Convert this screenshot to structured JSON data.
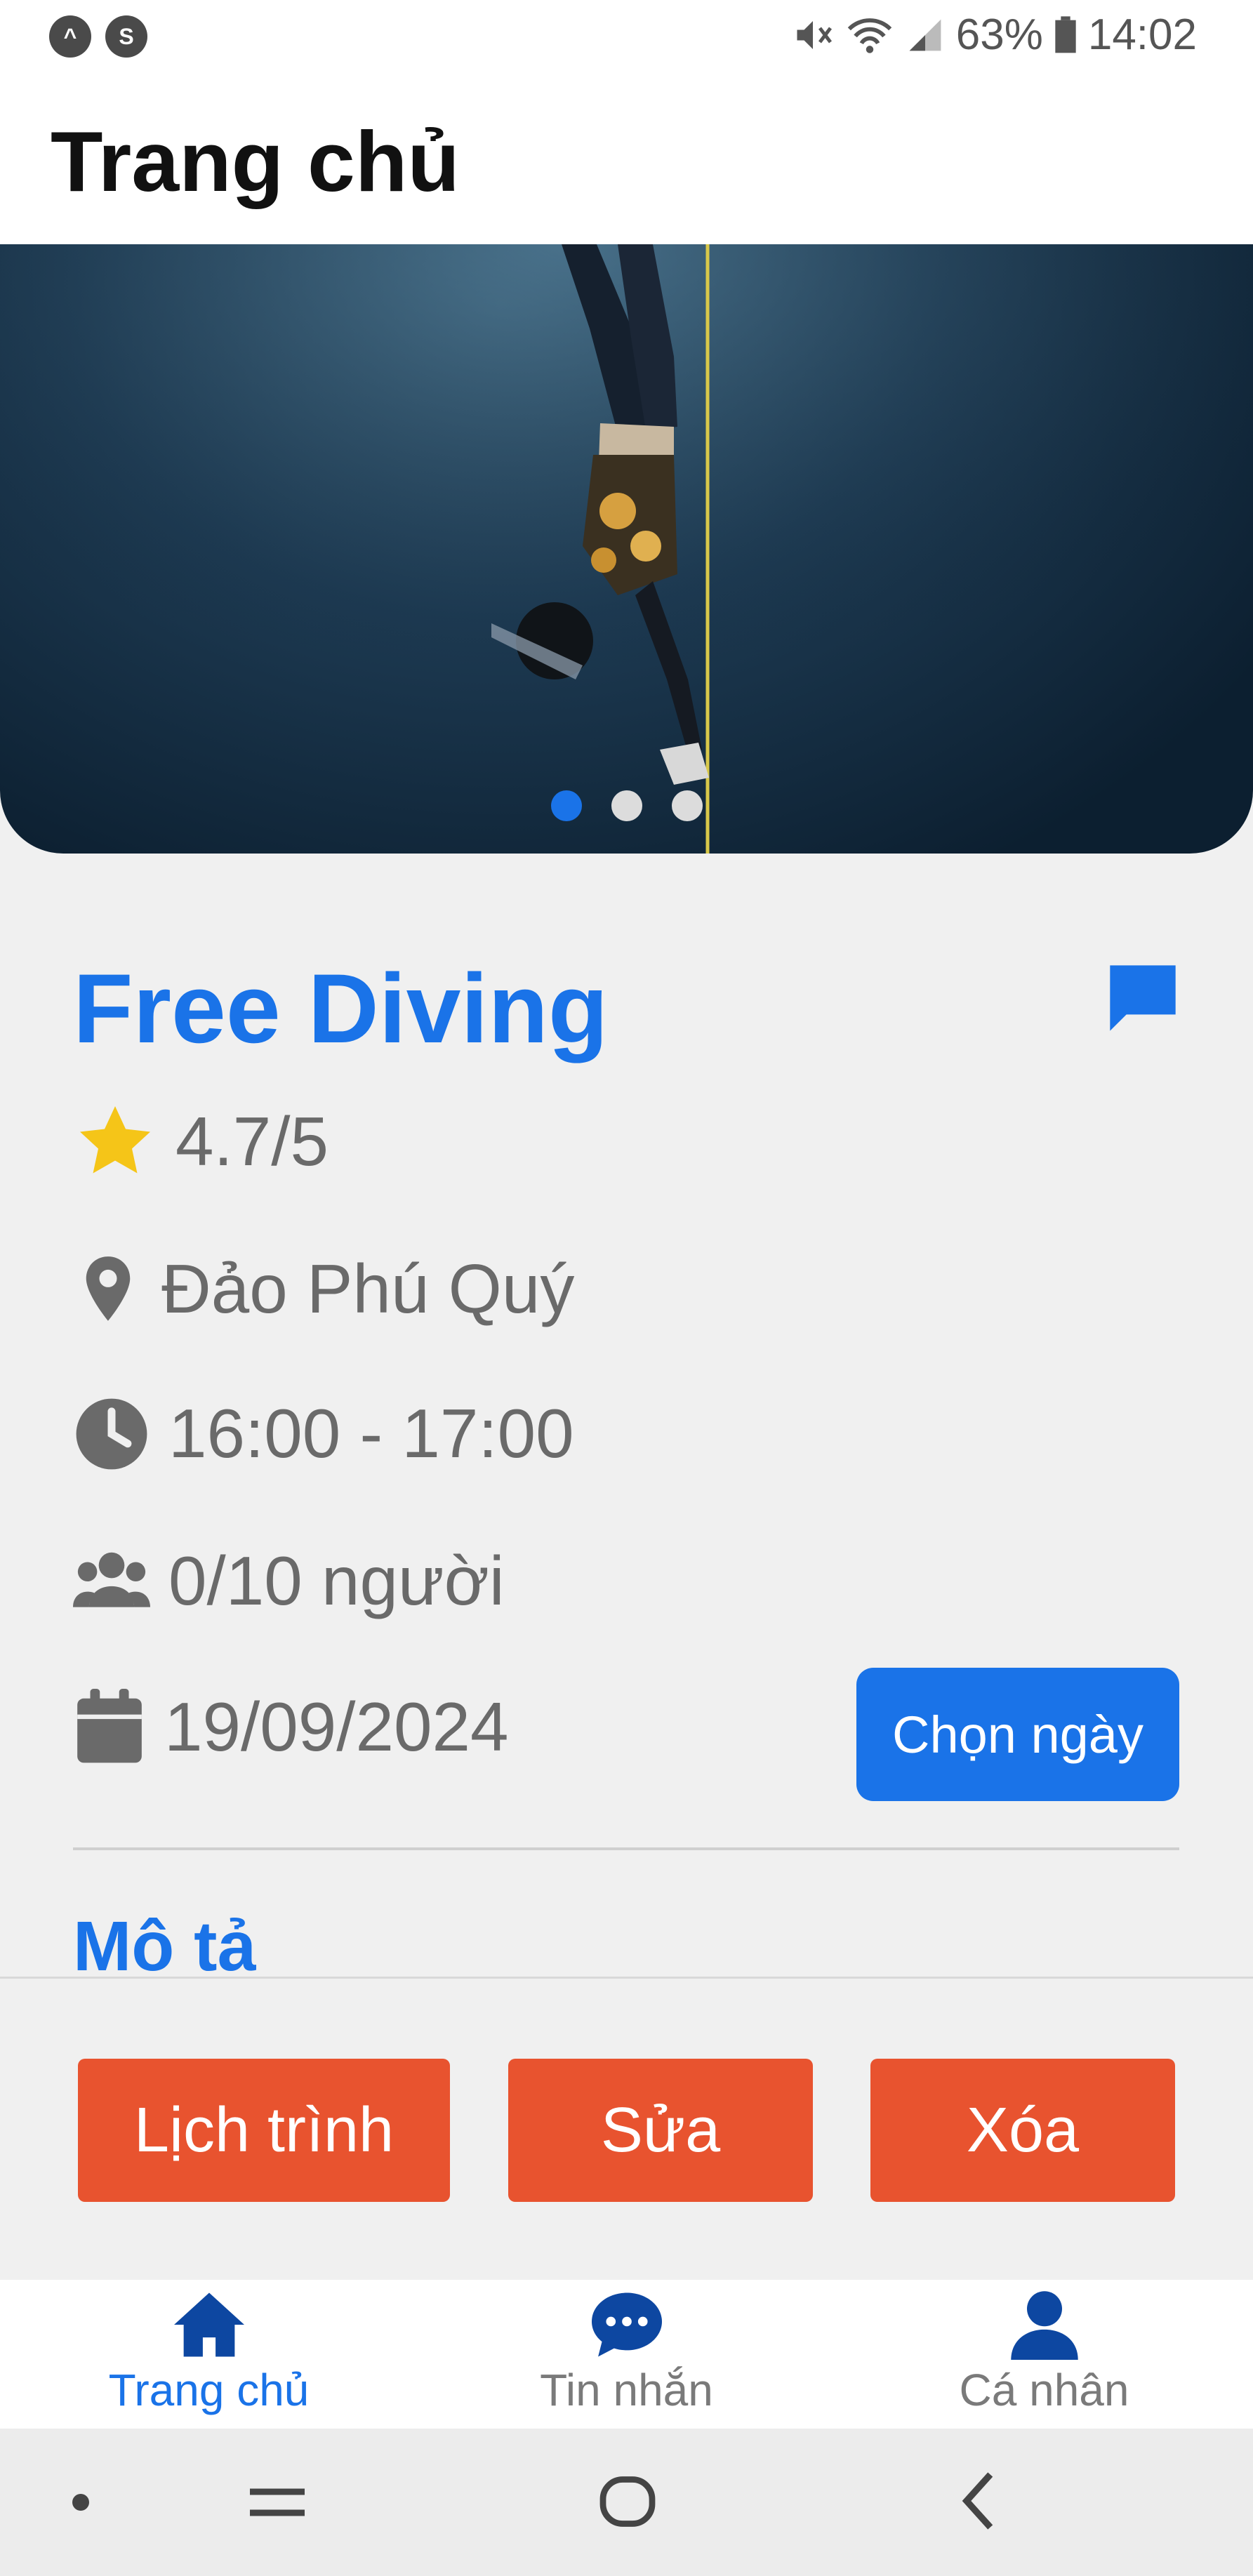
{
  "status_bar": {
    "left_icons": [
      "alert-icon",
      "shazam-icon"
    ],
    "battery_percent": "63%",
    "time": "14:02"
  },
  "header": {
    "title": "Trang chủ"
  },
  "carousel": {
    "pages": 3,
    "active_index": 0
  },
  "tour": {
    "title": "Free Diving",
    "rating": "4.7/5",
    "location": "Đảo Phú Quý",
    "time_range": "16:00 - 17:00",
    "capacity": "0/10 người",
    "date": "19/09/2024",
    "pick_date_label": "Chọn ngày",
    "description_label": "Mô tả"
  },
  "actions": {
    "schedule_label": "Lịch trình",
    "edit_label": "Sửa",
    "delete_label": "Xóa"
  },
  "bottom_nav": [
    {
      "label": "Trang chủ",
      "icon": "home-icon",
      "active": true
    },
    {
      "label": "Tin nhắn",
      "icon": "chat-icon",
      "active": false
    },
    {
      "label": "Cá nhân",
      "icon": "person-icon",
      "active": false
    }
  ],
  "colors": {
    "primary": "#1a73e8",
    "action": "#e8532f",
    "star": "#f5c518",
    "text_muted": "#6a6a6a"
  }
}
